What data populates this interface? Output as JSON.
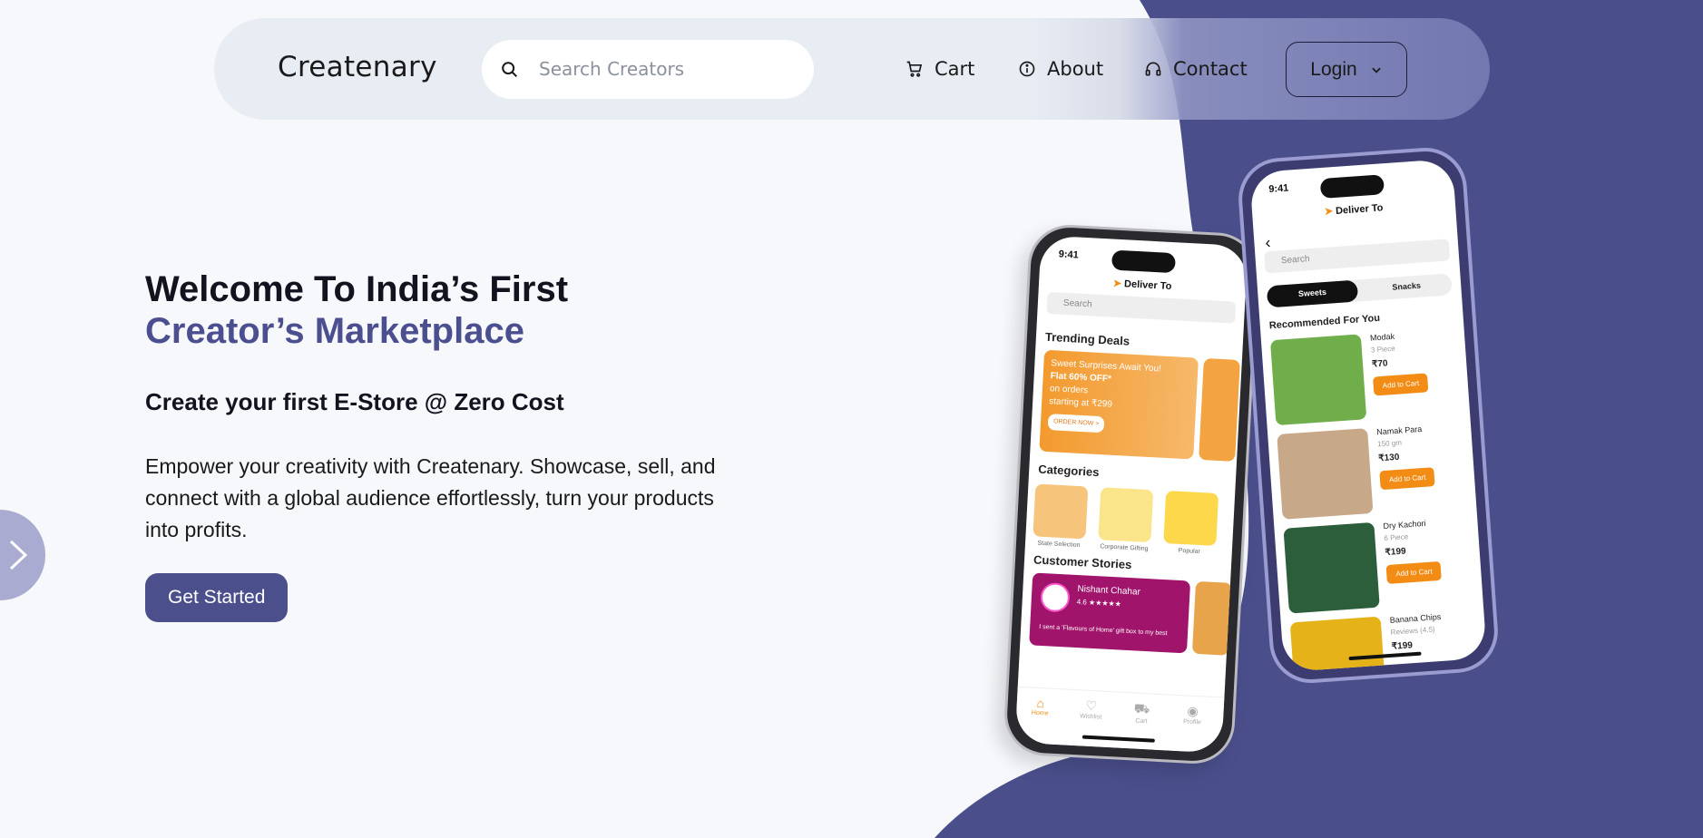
{
  "colors": {
    "accent": "#4b4f8c",
    "background": "#f6f8fb",
    "blob": "#4a4f8c",
    "cta": "#4b4f8c"
  },
  "header": {
    "brand": "Createnary",
    "search": {
      "placeholder": "Search Creators",
      "value": ""
    },
    "nav": {
      "cart": "Cart",
      "about": "About",
      "contact": "Contact",
      "login": "Login"
    }
  },
  "hero": {
    "title_line1": "Welcome To India’s First",
    "title_line2": "Creator’s Marketplace",
    "subtitle": "Create your first E-Store @ Zero Cost",
    "description": "Empower your creativity with Createnary. Showcase, sell, and connect with a global audience effortlessly, turn your products into profits.",
    "cta": "Get Started"
  },
  "phone_left": {
    "time": "9:41",
    "deliver": "Deliver To",
    "search": "Search",
    "trending_title": "Trending Deals",
    "deal_line1": "Sweet Surprises Await You!",
    "deal_line2": "Flat 60% OFF*",
    "deal_line3": "on orders",
    "deal_line4": "starting at ₹299",
    "deal_btn": "ORDER NOW >",
    "categories_title": "Categories",
    "categories": [
      "State Selection",
      "Corporate Gifting",
      "Popular"
    ],
    "stories_title": "Customer Stories",
    "story_name": "Nishant Chahar",
    "story_rating": "4.6 ★★★★★",
    "story_text": "I sent a 'Flavours of Home' gift box to my best",
    "tabs": [
      "Home",
      "Wishlist",
      "Cart",
      "Profile"
    ]
  },
  "phone_right": {
    "time": "9:41",
    "deliver": "Deliver To",
    "search": "Search",
    "tab_on": "Sweets",
    "tab_off": "Snacks",
    "recommended_title": "Recommended For You",
    "products": [
      {
        "name": "Modak",
        "sub": "3 Piece",
        "price": "₹70",
        "btn": "Add to Cart"
      },
      {
        "name": "Namak Para",
        "sub": "150 gm",
        "price": "₹130",
        "btn": "Add to Cart"
      },
      {
        "name": "Dry Kachori",
        "sub": "6 Piece",
        "price": "₹199",
        "btn": "Add to Cart"
      },
      {
        "name": "Banana Chips",
        "sub": "Reviews (4.5)",
        "price": "₹199",
        "btn": ""
      }
    ]
  }
}
